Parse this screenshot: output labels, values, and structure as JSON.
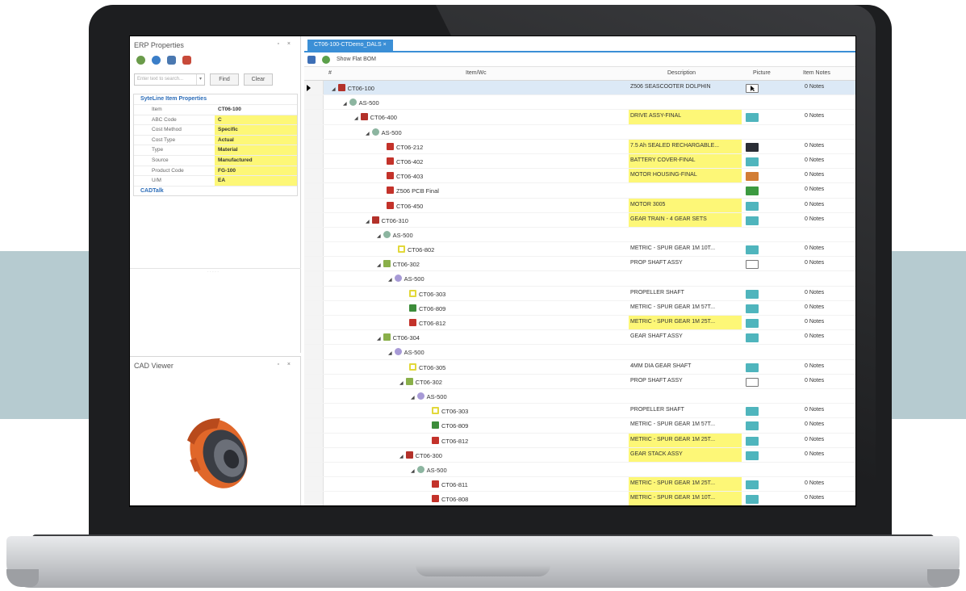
{
  "erp": {
    "title": "ERP Properties",
    "window_controls": "▫ ×",
    "search_placeholder": "Enter text to search...",
    "find_label": "Find",
    "clear_label": "Clear",
    "section_title": "SyteLine Item Properties",
    "properties": [
      {
        "key": "Item",
        "value": "CT06-100",
        "highlight": false
      },
      {
        "key": "ABC Code",
        "value": "C",
        "highlight": true
      },
      {
        "key": "Cost Method",
        "value": "Specific",
        "highlight": true
      },
      {
        "key": "Cost Type",
        "value": "Actual",
        "highlight": true
      },
      {
        "key": "Type",
        "value": "Material",
        "highlight": true
      },
      {
        "key": "Source",
        "value": "Manufactured",
        "highlight": true
      },
      {
        "key": "Product Code",
        "value": "FG-100",
        "highlight": true
      },
      {
        "key": "U/M",
        "value": "EA",
        "highlight": true
      }
    ],
    "cadtalk_label": "CADTalk"
  },
  "cad": {
    "title": "CAD Viewer",
    "window_controls": "▫ ×"
  },
  "doc": {
    "tab_label": "CT06-100-CTDemo_DALS ×",
    "show_flat_bom": "Show Flat BOM",
    "columns": {
      "hash": "#",
      "item": "Item/Wc",
      "description": "Description",
      "picture": "Picture",
      "notes": "Item Notes"
    },
    "rows": [
      {
        "item": "CT06-100",
        "level": 0,
        "expand": true,
        "icon": "assembly",
        "description": "Z506 SEASCOOTER DOLPHIN",
        "hl": false,
        "pic": "pointer",
        "notes": "0 Notes",
        "selected": true
      },
      {
        "item": "AS-500",
        "level": 1,
        "expand": true,
        "icon": "workcenter",
        "description": "",
        "hl": false,
        "pic": "",
        "notes": ""
      },
      {
        "item": "CT06-400",
        "level": 2,
        "expand": true,
        "icon": "assembly",
        "description": "DRIVE ASSY-FINAL",
        "hl": true,
        "pic": "teal",
        "notes": "0 Notes"
      },
      {
        "item": "AS-500",
        "level": 3,
        "expand": true,
        "icon": "workcenter",
        "description": "",
        "hl": false,
        "pic": "",
        "notes": ""
      },
      {
        "item": "CT06-212",
        "level": 4,
        "expand": false,
        "icon": "part-red",
        "description": "7.5 Ah SEALED RECHARGABLE...",
        "hl": true,
        "pic": "dark",
        "notes": "0 Notes"
      },
      {
        "item": "CT06-402",
        "level": 4,
        "expand": false,
        "icon": "part-red",
        "description": "BATTERY COVER-FINAL",
        "hl": true,
        "pic": "teal",
        "notes": "0 Notes"
      },
      {
        "item": "CT06-403",
        "level": 4,
        "expand": false,
        "icon": "part-red",
        "description": "MOTOR HOUSING-FINAL",
        "hl": true,
        "pic": "orange",
        "notes": "0 Notes"
      },
      {
        "item": "Z506 PCB Final",
        "level": 4,
        "expand": false,
        "icon": "part-red",
        "description": "",
        "hl": false,
        "pic": "green",
        "notes": "0 Notes"
      },
      {
        "item": "CT06-450",
        "level": 4,
        "expand": false,
        "icon": "part-red",
        "description": "MOTOR 3005",
        "hl": true,
        "pic": "teal",
        "notes": "0 Notes"
      },
      {
        "item": "CT06-310",
        "level": 3,
        "expand": true,
        "icon": "assembly",
        "description": "GEAR TRAIN - 4 GEAR SETS",
        "hl": true,
        "pic": "teal",
        "notes": "0 Notes"
      },
      {
        "item": "AS-500",
        "level": 4,
        "expand": true,
        "icon": "workcenter",
        "description": "",
        "hl": false,
        "pic": "",
        "notes": ""
      },
      {
        "item": "CT06-802",
        "level": 5,
        "expand": false,
        "icon": "part-yellow",
        "description": "METRIC - SPUR GEAR 1M 10T...",
        "hl": false,
        "pic": "teal",
        "notes": "0 Notes"
      },
      {
        "item": "CT06-302",
        "level": 4,
        "expand": true,
        "icon": "assembly-green",
        "description": "PROP SHAFT ASSY",
        "hl": false,
        "pic": "white",
        "notes": "0 Notes"
      },
      {
        "item": "AS-500",
        "level": 5,
        "expand": true,
        "icon": "workcenter-purple",
        "description": "",
        "hl": false,
        "pic": "",
        "notes": ""
      },
      {
        "item": "CT06-303",
        "level": 6,
        "expand": false,
        "icon": "part-yellow",
        "description": "PROPELLER SHAFT",
        "hl": false,
        "pic": "teal",
        "notes": "0 Notes"
      },
      {
        "item": "CT06-809",
        "level": 6,
        "expand": false,
        "icon": "part-green",
        "description": "METRIC - SPUR GEAR 1M 57T...",
        "hl": false,
        "pic": "teal",
        "notes": "0 Notes"
      },
      {
        "item": "CT06-812",
        "level": 6,
        "expand": false,
        "icon": "part-red",
        "description": "METRIC - SPUR GEAR 1M 25T...",
        "hl": true,
        "pic": "teal",
        "notes": "0 Notes"
      },
      {
        "item": "CT06-304",
        "level": 4,
        "expand": true,
        "icon": "assembly-green",
        "description": "GEAR SHAFT ASSY",
        "hl": false,
        "pic": "teal",
        "notes": "0 Notes"
      },
      {
        "item": "AS-500",
        "level": 5,
        "expand": true,
        "icon": "workcenter-purple",
        "description": "",
        "hl": false,
        "pic": "",
        "notes": ""
      },
      {
        "item": "CT06-305",
        "level": 6,
        "expand": false,
        "icon": "part-yellow",
        "description": "4MM DIA GEAR SHAFT",
        "hl": false,
        "pic": "teal",
        "notes": "0 Notes"
      },
      {
        "item": "CT06-302",
        "level": 6,
        "expand": true,
        "icon": "assembly-green",
        "description": "PROP SHAFT ASSY",
        "hl": false,
        "pic": "white",
        "notes": "0 Notes"
      },
      {
        "item": "AS-500",
        "level": 7,
        "expand": true,
        "icon": "workcenter-purple",
        "description": "",
        "hl": false,
        "pic": "",
        "notes": ""
      },
      {
        "item": "CT06-303",
        "level": 8,
        "expand": false,
        "icon": "part-yellow",
        "description": "PROPELLER SHAFT",
        "hl": false,
        "pic": "teal",
        "notes": "0 Notes"
      },
      {
        "item": "CT06-809",
        "level": 8,
        "expand": false,
        "icon": "part-green",
        "description": "METRIC - SPUR GEAR 1M 57T...",
        "hl": false,
        "pic": "teal",
        "notes": "0 Notes"
      },
      {
        "item": "CT06-812",
        "level": 8,
        "expand": false,
        "icon": "part-red",
        "description": "METRIC - SPUR GEAR 1M 25T...",
        "hl": true,
        "pic": "teal",
        "notes": "0 Notes"
      },
      {
        "item": "CT06-300",
        "level": 6,
        "expand": true,
        "icon": "assembly",
        "description": "GEAR STACK ASSY",
        "hl": true,
        "pic": "teal",
        "notes": "0 Notes"
      },
      {
        "item": "AS-500",
        "level": 7,
        "expand": true,
        "icon": "workcenter",
        "description": "",
        "hl": false,
        "pic": "",
        "notes": ""
      },
      {
        "item": "CT06-811",
        "level": 8,
        "expand": false,
        "icon": "part-red",
        "description": "METRIC - SPUR GEAR 1M 25T...",
        "hl": true,
        "pic": "teal",
        "notes": "0 Notes"
      },
      {
        "item": "CT06-808",
        "level": 8,
        "expand": false,
        "icon": "part-red",
        "description": "METRIC - SPUR GEAR 1M 10T...",
        "hl": true,
        "pic": "teal",
        "notes": "0 Notes"
      }
    ]
  },
  "colors": {
    "highlight": "#fdf777",
    "accent": "#3b8fd6",
    "band": "#b6cbd0"
  }
}
